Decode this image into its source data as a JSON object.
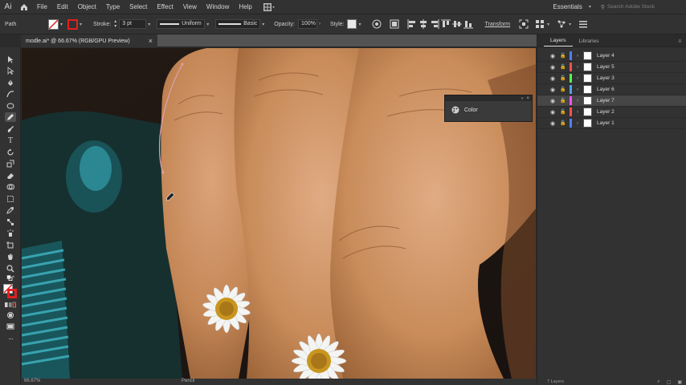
{
  "menubar": {
    "app_logo": "Ai",
    "items": [
      "File",
      "Edit",
      "Object",
      "Type",
      "Select",
      "Effect",
      "View",
      "Window",
      "Help"
    ],
    "workspace": "Essentials",
    "search_placeholder": "Search Adobe Stock"
  },
  "control_bar": {
    "selection_label": "Path",
    "stroke_label": "Stroke:",
    "stroke_value": "3 pt",
    "profile_value": "Uniform",
    "brush_value": "Basic",
    "opacity_label": "Opacity:",
    "opacity_value": "100%",
    "style_label": "Style:",
    "transform_label": "Transform"
  },
  "document_tab": {
    "title": "modle.ai* @ 66.67% (RGB/GPU Preview)",
    "close_glyph": "×"
  },
  "status_bar": {
    "zoom": "66.67%",
    "tool": "Pencil"
  },
  "layers_panel": {
    "tabs": [
      "Layers",
      "Libraries"
    ],
    "layers": [
      {
        "name": "Layer 4",
        "color": "#4f7fff",
        "selected": false
      },
      {
        "name": "Layer 5",
        "color": "#ff4f4f",
        "selected": false
      },
      {
        "name": "Layer 3",
        "color": "#4fff4f",
        "selected": false
      },
      {
        "name": "Layer 6",
        "color": "#4f9fff",
        "selected": false
      },
      {
        "name": "Layer 7",
        "color": "#ff4fff",
        "selected": true
      },
      {
        "name": "Layer 2",
        "color": "#ff4f4f",
        "selected": false
      },
      {
        "name": "Layer 1",
        "color": "#4f7fff",
        "selected": false
      }
    ],
    "count_label": "7 Layers"
  },
  "color_panel": {
    "title": "Color"
  },
  "colors": {
    "ui_bg": "#323232",
    "canvas_bg": "#241812",
    "skin": "#c98c5a",
    "path_stroke": "#d9a3b0"
  }
}
